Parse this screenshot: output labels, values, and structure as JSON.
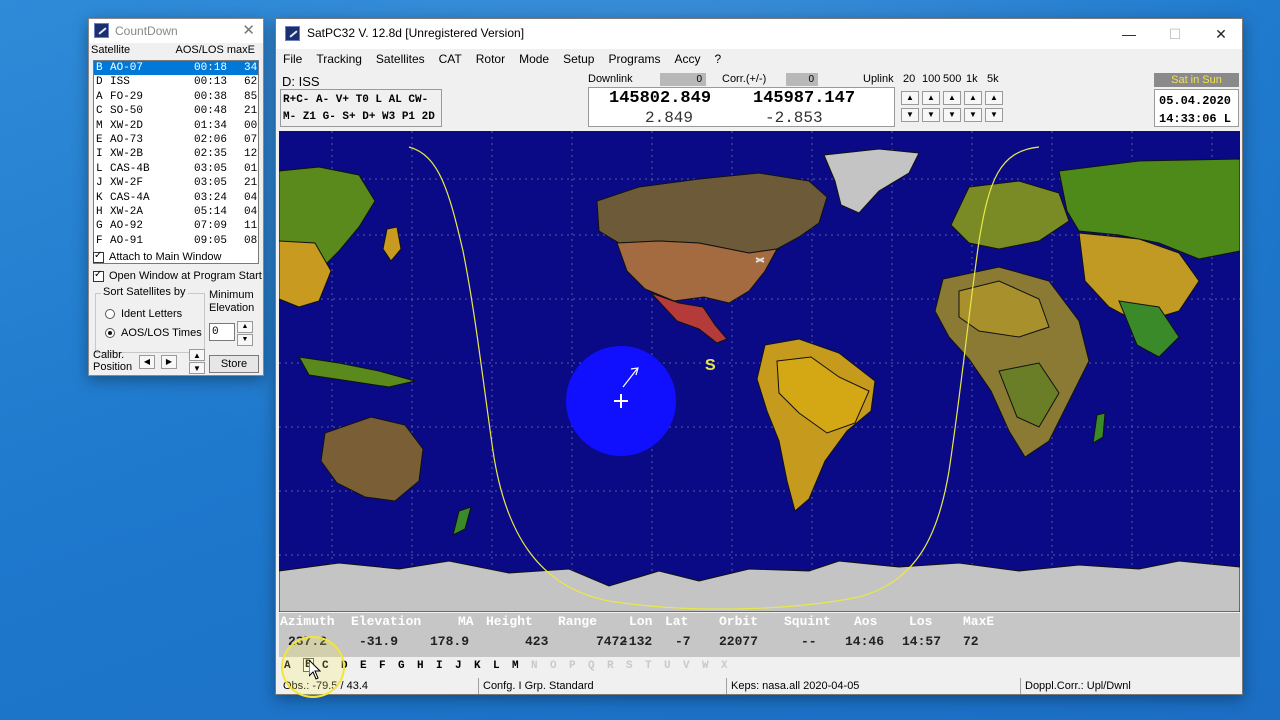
{
  "countdown": {
    "title": "CountDown",
    "col_satellite": "Satellite",
    "col_aoslos": "AOS/LOS maxE",
    "rows": [
      {
        "id": "B",
        "name": "AO-07",
        "time": "00:18",
        "maxe": "34",
        "selected": true
      },
      {
        "id": "D",
        "name": "ISS",
        "time": "00:13",
        "maxe": "62"
      },
      {
        "id": "A",
        "name": "FO-29",
        "time": "00:38",
        "maxe": "85"
      },
      {
        "id": "C",
        "name": "SO-50",
        "time": "00:48",
        "maxe": "21"
      },
      {
        "id": "M",
        "name": "XW-2D",
        "time": "01:34",
        "maxe": "00"
      },
      {
        "id": "E",
        "name": "AO-73",
        "time": "02:06",
        "maxe": "07"
      },
      {
        "id": "I",
        "name": "XW-2B",
        "time": "02:35",
        "maxe": "12"
      },
      {
        "id": "L",
        "name": "CAS-4B",
        "time": "03:05",
        "maxe": "01"
      },
      {
        "id": "J",
        "name": "XW-2F",
        "time": "03:05",
        "maxe": "21"
      },
      {
        "id": "K",
        "name": "CAS-4A",
        "time": "03:24",
        "maxe": "04"
      },
      {
        "id": "H",
        "name": "XW-2A",
        "time": "05:14",
        "maxe": "04"
      },
      {
        "id": "G",
        "name": "AO-92",
        "time": "07:09",
        "maxe": "11"
      },
      {
        "id": "F",
        "name": "AO-91",
        "time": "09:05",
        "maxe": "08"
      }
    ],
    "attach_label": "Attach to Main Window",
    "open_label": "Open Window at Program Start",
    "sort_legend": "Sort Satellites by",
    "sort_ident": "Ident Letters",
    "sort_aos": "AOS/LOS Times",
    "min_elev_line1": "Minimum",
    "min_elev_line2": "Elevation",
    "min_elev_value": "0",
    "calib_line1": "Calibr.",
    "calib_line2": "Position",
    "store_label": "Store"
  },
  "main": {
    "title": "SatPC32 V. 12.8d  [Unregistered Version]",
    "menu": [
      "File",
      "Tracking",
      "Satellites",
      "CAT",
      "Rotor",
      "Mode",
      "Setup",
      "Programs",
      "Accy",
      "?"
    ],
    "sat_label": "D: ISS",
    "mode_line1": "R+C- A- V+ T0 L AL CW-",
    "mode_line2": "M- Z1 G- S+ D+ W3 P1 2D",
    "downlink_label": "Downlink",
    "downlink_off": "0",
    "corr_label": "Corr.(+/-)",
    "corr_val": "0",
    "uplink_label": "Uplink",
    "steps": [
      "20",
      "100",
      "500",
      "1k",
      "5k"
    ],
    "freq_down": "145802.849",
    "freq_up": "145987.147",
    "dopp_down": "2.849",
    "dopp_up": "-2.853",
    "sun_status": "Sat in Sun",
    "date": "05.04.2020",
    "time": "14:33:06 L",
    "map_sat_marker": "S",
    "data_headers": [
      "Azimuth",
      "Elevation",
      "MA",
      "Height",
      "Range",
      "Lon",
      "Lat",
      "Orbit",
      "Squint",
      "Aos",
      "Los",
      "MaxE"
    ],
    "data_values": [
      "237.2",
      "-31.9",
      "178.9",
      "423",
      "7472",
      "-132",
      "-7",
      "22077",
      "--",
      "14:46",
      "14:57",
      "72"
    ],
    "letters": [
      "A",
      "B",
      "C",
      "D",
      "E",
      "F",
      "G",
      "H",
      "I",
      "J",
      "K",
      "L",
      "M",
      "N",
      "O",
      "P",
      "Q",
      "R",
      "S",
      "T",
      "U",
      "V",
      "W",
      "X"
    ],
    "letters_active_count": 13,
    "letter_selected": "B",
    "status": {
      "obs": "Obs.: -79.5 / 43.4",
      "config": "Confg. I  Grp. Standard",
      "keps": "Keps: nasa.all 2020-04-05",
      "doppl": "Doppl.Corr.: Upl/Dwnl"
    }
  },
  "colors": {
    "ocean": "#0a0a86",
    "footprint": "#1010ff",
    "selected_row": "#0078d7",
    "track": "#e8e84a",
    "sun_text": "#f2e24c"
  }
}
